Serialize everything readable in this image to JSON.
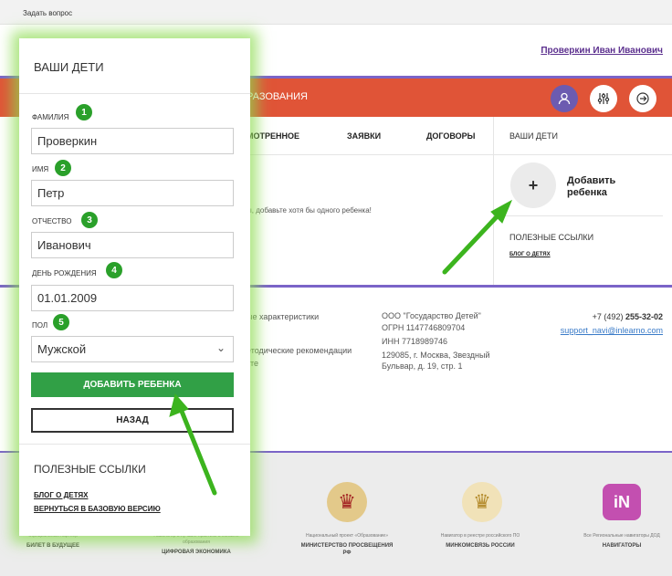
{
  "topbar": {
    "ask_question": "Задать вопрос"
  },
  "header": {
    "user_name": "Проверкин Иван Иванович"
  },
  "banner": {
    "title": "РАЗОВАНИЯ"
  },
  "tabs": [
    "МОТРЕННОЕ",
    "ЗАЯВКИ",
    "ДОГОВОРЫ"
  ],
  "right_panel": {
    "title": "ВАШИ ДЕТИ",
    "add_child": "Добавить ребенка",
    "useful_links": "ПОЛЕЗНЫЕ ССЫЛКИ",
    "blog": "БЛОГ О ДЕТЯХ"
  },
  "main": {
    "empty_hint": "ы, добавьте хотя бы одного ребенка!"
  },
  "footer": {
    "col1": [
      "ые характеристики",
      "етодические рекомендации",
      "кте"
    ],
    "col2": [
      "ООО \"Государство Детей\"",
      "ОГРН 1147746809704",
      "ИНН 7718989746",
      "129085, г. Москва, Звездный",
      "Бульвар, д. 19, стр. 1"
    ],
    "phone_prefix": "+7 (492) ",
    "phone_main": "255-32-02",
    "email": "support_navi@inlearno.com"
  },
  "partners": [
    {
      "small": "Официальный партнёр",
      "big": "БИЛЕТ В БУДУЩЕЕ"
    },
    {
      "small": "Навигатор в лучшие практики в области образования",
      "big": "ЦИФРОВАЯ ЭКОНОМИКА"
    },
    {
      "small": "Национальный проект «Образование»",
      "big": "МИНИСТЕРСТВО ПРОСВЕЩЕНИЯ РФ"
    },
    {
      "small": "Навигатор в реестре российского ПО",
      "big": "МИНКОМСВЯЗЬ РОССИИ"
    },
    {
      "small": "Все Региональные навигаторы ДОД",
      "big": "НАВИГАТОРЫ"
    }
  ],
  "modal": {
    "title": "ВАШИ ДЕТИ",
    "fields": [
      {
        "label": "ФАМИЛИЯ",
        "value": "Проверкин",
        "badge": "1"
      },
      {
        "label": "ИМЯ",
        "value": "Петр",
        "badge": "2"
      },
      {
        "label": "ОТЧЕСТВО",
        "value": "Иванович",
        "badge": "3"
      },
      {
        "label": "ДЕНЬ РОЖДЕНИЯ",
        "value": "01.01.2009",
        "badge": "4"
      },
      {
        "label": "ПОЛ",
        "value": "Мужской",
        "badge": "5"
      }
    ],
    "add_button": "ДОБАВИТЬ РЕБЕНКА",
    "back_button": "НАЗАД",
    "useful_links": "ПОЛЕЗНЫЕ ССЫЛКИ",
    "link_blog": "БЛОГ О ДЕТЯХ",
    "link_base": "ВЕРНУТЬСЯ В БАЗОВУЮ ВЕРСИЮ"
  },
  "colors": {
    "accent_green": "#31a046",
    "banner_orange": "#e05437",
    "brand_purple": "#7b64c8",
    "badge_green": "#2aa02a"
  }
}
